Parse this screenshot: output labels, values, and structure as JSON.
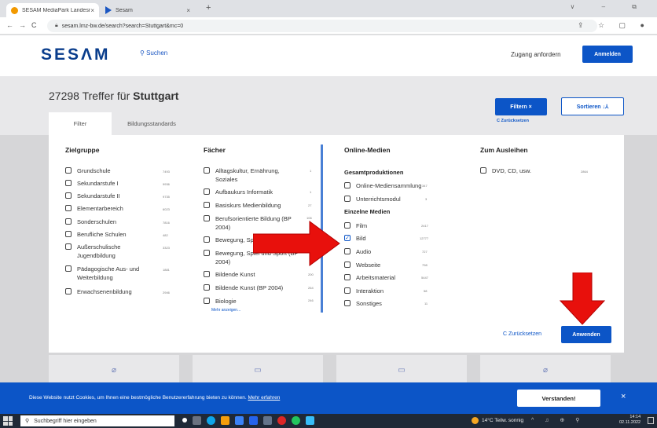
{
  "browser": {
    "tabs": [
      {
        "title": "SESAM MediaPark Landesmed",
        "close": "×",
        "favicon_color": "#f29900"
      },
      {
        "title": "Sesam",
        "close": "×",
        "favicon_color": "#1a56c2"
      }
    ],
    "new_tab": "+",
    "window_controls": "∨ – ⧉",
    "nav": {
      "back": "←",
      "forward": "→",
      "reload": "C"
    },
    "url": "sesam.lmz-bw.de/search?search=Stuttgart&mc=0",
    "icons": "⇪ ☆ ▢ ●"
  },
  "site": {
    "logo": "SESΛM",
    "search_label": "Suchen",
    "request_access": "Zugang anfordern",
    "login": "Anmelden"
  },
  "results": {
    "count_prefix": "27298 Treffer für",
    "query": "Stuttgart",
    "filter_button": "Filtern ×",
    "sort_button": "Sortieren ↓⅄",
    "reset_top": "C Zurücksetzen",
    "tabs": [
      "Filter",
      "Bildungsstandards"
    ]
  },
  "filters": {
    "zielgruppe": {
      "title": "Zielgruppe",
      "items": [
        {
          "label": "Grundschule",
          "count": "7493"
        },
        {
          "label": "Sekundarstufe I",
          "count": "9936"
        },
        {
          "label": "Sekundarstufe II",
          "count": "9735"
        },
        {
          "label": "Elementarbereich",
          "count": "6023"
        },
        {
          "label": "Sonderschulen",
          "count": "7816"
        },
        {
          "label": "Berufliche Schulen",
          "count": "482"
        },
        {
          "label": "Außerschulische Jugendbildung",
          "count": "3323"
        },
        {
          "label": "Pädagogische Aus- und Weiterbildung",
          "count": "1881"
        },
        {
          "label": "Erwachsenenbildung",
          "count": "2946"
        }
      ]
    },
    "faecher": {
      "title": "Fächer",
      "items": [
        {
          "label": "Alltagskultur, Ernährung, Soziales",
          "count": "1"
        },
        {
          "label": "Aufbaukurs Informatik",
          "count": "1"
        },
        {
          "label": "Basiskurs Medienbildung",
          "count": "27"
        },
        {
          "label": "Berufsorientierte Bildung (BP 2004)",
          "count": "106"
        },
        {
          "label": "Bewegung, Spiel und Sport",
          "count": "2"
        },
        {
          "label": "Bewegung, Spiel und Sport (BP 2004)",
          "count": "9"
        },
        {
          "label": "Bildende Kunst",
          "count": "200"
        },
        {
          "label": "Bildende Kunst (BP 2004)",
          "count": "264"
        },
        {
          "label": "Biologie",
          "count": "246"
        }
      ],
      "more": "Mehr anzeigen..."
    },
    "online": {
      "title": "Online-Medien",
      "gesamt_title": "Gesamtproduktionen",
      "gesamt_items": [
        {
          "label": "Online-Mediensammlung",
          "count": "347"
        },
        {
          "label": "Unterrichtsmodul",
          "count": "3"
        }
      ],
      "einzel_title": "Einzelne Medien",
      "einzel_items": [
        {
          "label": "Film",
          "count": "2417",
          "checked": false
        },
        {
          "label": "Bild",
          "count": "12777",
          "checked": true
        },
        {
          "label": "Audio",
          "count": "727",
          "checked": false
        },
        {
          "label": "Webseite",
          "count": "798",
          "checked": false
        },
        {
          "label": "Arbeitsmaterial",
          "count": "5447",
          "checked": false
        },
        {
          "label": "Interaktion",
          "count": "58",
          "checked": false
        },
        {
          "label": "Sonstiges",
          "count": "11",
          "checked": false
        }
      ]
    },
    "ausleihen": {
      "title": "Zum Ausleihen",
      "items": [
        {
          "label": "DVD, CD, usw.",
          "count": "2864"
        }
      ]
    },
    "reset": "C Zurücksetzen",
    "apply": "Anwenden"
  },
  "cookie": {
    "text": "Diese Website nutzt Cookies, um Ihnen eine bestmögliche Benutzererfahrung bieten zu können.",
    "link": "Mehr erfahren",
    "accept": "Verstanden!",
    "close": "×"
  },
  "taskbar": {
    "search_placeholder": "Suchbegriff hier eingeben",
    "weather": "14°C Teilw. sonnig",
    "tray": "^ ♫ ⊕ ⚲",
    "time": "14:14",
    "date": "02.11.2022"
  },
  "colors": {
    "accent": "#0c55c7",
    "arrow": "#e8100c"
  }
}
